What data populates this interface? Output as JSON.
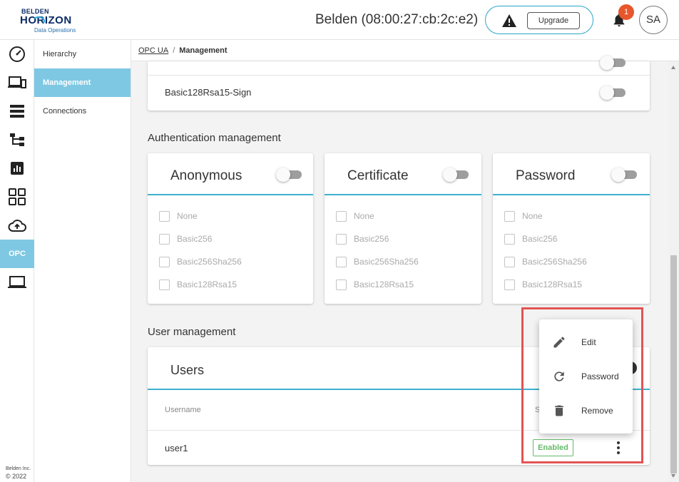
{
  "header": {
    "logo_top": "BELDEN",
    "logo_main": "HORIZON",
    "logo_tm": "™",
    "logo_sub": "Data Operations",
    "device_title": "Belden (08:00:27:cb:2c:e2)",
    "upgrade_label": "Upgrade",
    "notification_count": "1",
    "avatar_initials": "SA"
  },
  "rail": {
    "opc_label": "OPC",
    "footer_company": "Belden Inc.",
    "footer_copyright": "© 2022"
  },
  "subnav": {
    "items": [
      {
        "label": "Hierarchy"
      },
      {
        "label": "Management"
      },
      {
        "label": "Connections"
      }
    ]
  },
  "breadcrumb": {
    "parent": "OPC UA",
    "separator": "/",
    "current": "Management"
  },
  "security_policies": {
    "visible_row": "Basic128Rsa15-Sign"
  },
  "authentication": {
    "section_title": "Authentication management",
    "cards": [
      {
        "title": "Anonymous",
        "options": [
          "None",
          "Basic256",
          "Basic256Sha256",
          "Basic128Rsa15"
        ]
      },
      {
        "title": "Certificate",
        "options": [
          "None",
          "Basic256",
          "Basic256Sha256",
          "Basic128Rsa15"
        ]
      },
      {
        "title": "Password",
        "options": [
          "None",
          "Basic256",
          "Basic256Sha256",
          "Basic128Rsa15"
        ]
      }
    ]
  },
  "users": {
    "section_title": "User management",
    "card_title": "Users",
    "col_username": "Username",
    "col_status_partial": "S",
    "rows": [
      {
        "username": "user1",
        "status": "Enabled"
      }
    ]
  },
  "context_menu": {
    "items": [
      {
        "label": "Edit",
        "icon": "pencil-icon"
      },
      {
        "label": "Password",
        "icon": "refresh-icon"
      },
      {
        "label": "Remove",
        "icon": "trash-icon"
      }
    ]
  },
  "colors": {
    "accent": "#7ec8e3",
    "divider_accent": "#3fb0d0",
    "badge": "#e8562c",
    "enabled": "#66bb6a",
    "highlight": "#e35353"
  }
}
